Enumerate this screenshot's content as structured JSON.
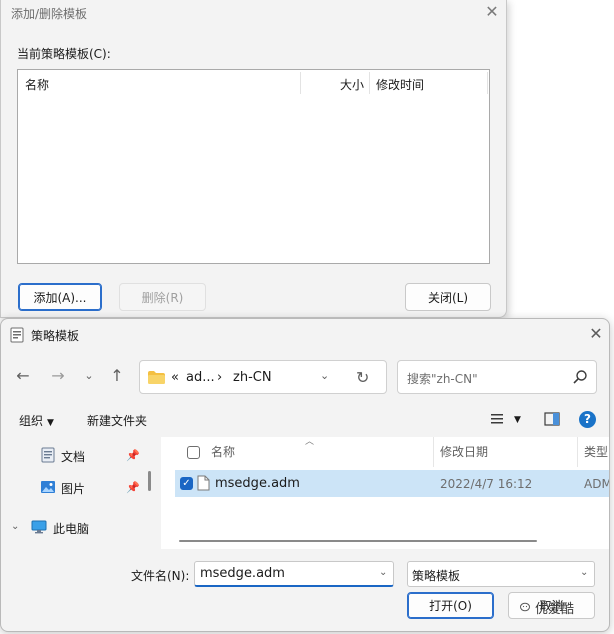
{
  "top_dialog": {
    "title": "添加/删除模板",
    "section_label": "当前策略模板(C):",
    "columns": [
      "名称",
      "大小",
      "修改时间"
    ],
    "add_label": "添加(A)...",
    "delete_label": "删除(R)",
    "close_label": "关闭(L)"
  },
  "file_dialog": {
    "title": "策略模板",
    "address": {
      "overflow": "«",
      "segment1": "ad...",
      "separator": "›",
      "segment2": "zh-CN"
    },
    "search_placeholder": "搜索\"zh-CN\"",
    "toolbar": {
      "organize": "组织",
      "new_folder": "新建文件夹"
    },
    "nav": [
      {
        "label": "文档",
        "icon": "document-icon"
      },
      {
        "label": "图片",
        "icon": "picture-icon"
      },
      {
        "label": "此电脑",
        "icon": "computer-icon"
      }
    ],
    "file_columns": {
      "name": "名称",
      "modified": "修改日期",
      "type": "类型"
    },
    "files": [
      {
        "name": "msedge.adm",
        "modified": "2022/4/7 16:12",
        "type": "ADM"
      }
    ],
    "filename_label": "文件名(N):",
    "filename_value": "msedge.adm",
    "filetype_value": "策略模板",
    "open_label": "打开(O)",
    "cancel_label": "取消"
  },
  "watermark": "优爱酷",
  "colors": {
    "accent": "#1a66c4",
    "selected_row": "#cce4f7",
    "folder": "#f4c042"
  }
}
